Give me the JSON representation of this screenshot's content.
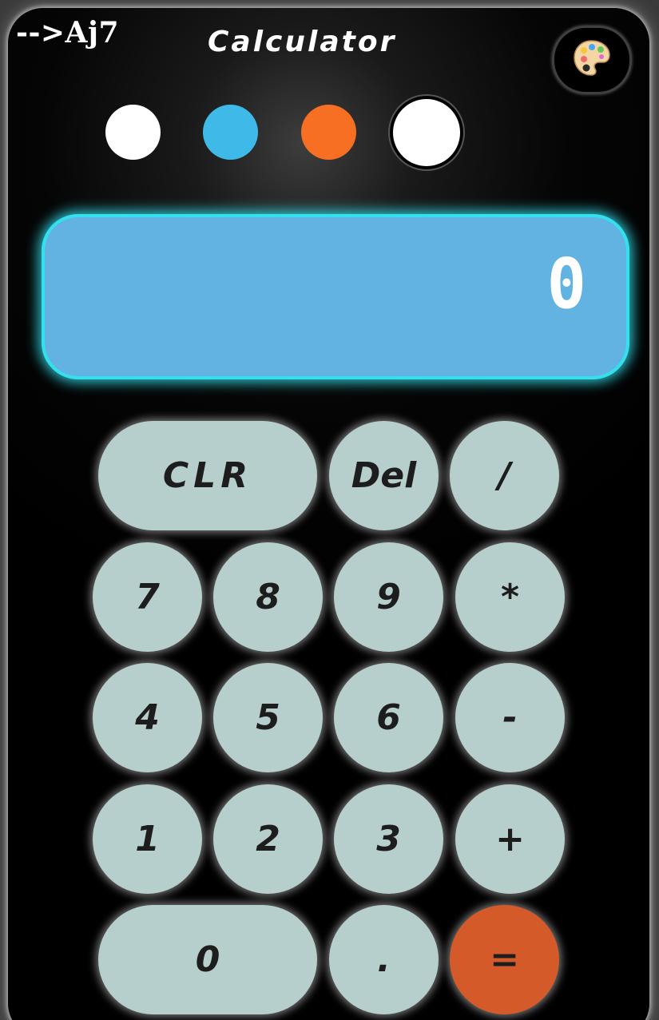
{
  "header": {
    "brand": "-->Aj7",
    "title": "Calculator",
    "theme_button_icon": "palette-icon"
  },
  "theme_swatches": [
    {
      "color": "#ffffff",
      "selected": false
    },
    {
      "color": "#3fb9e8",
      "selected": false
    },
    {
      "color": "#f76f22",
      "selected": false
    },
    {
      "color": "#ffffff",
      "selected": true
    }
  ],
  "display": {
    "value": "0"
  },
  "keys": {
    "clear": "CLR",
    "delete": "Del",
    "divide": "/",
    "seven": "7",
    "eight": "8",
    "nine": "9",
    "multiply": "*",
    "four": "4",
    "five": "5",
    "six": "6",
    "subtract": "-",
    "one": "1",
    "two": "2",
    "three": "3",
    "add": "+",
    "zero": "0",
    "decimal": ".",
    "equals": "="
  },
  "colors": {
    "key_background": "#b6cfcd",
    "equals_background": "#d55a2a",
    "display_background": "#62b3e1",
    "display_glow": "#34e0ee"
  }
}
